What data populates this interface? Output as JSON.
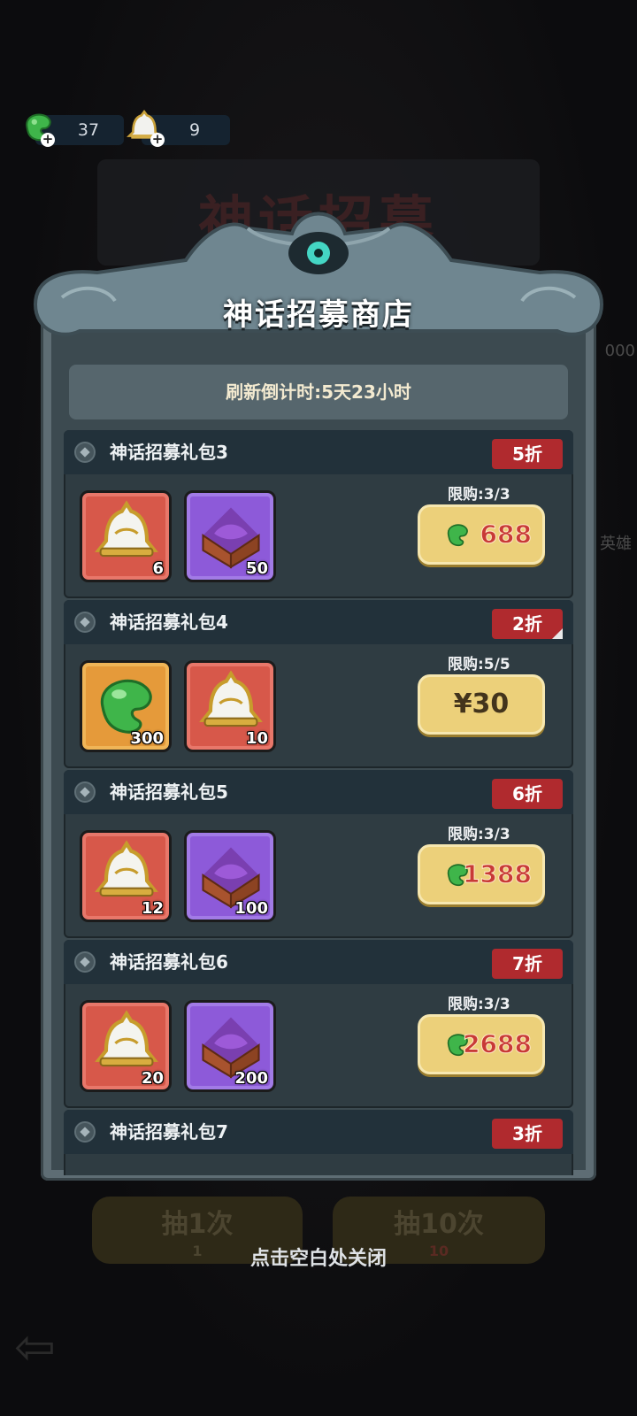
{
  "background": {
    "title": "神话招募",
    "side_number": "000",
    "side_label": "英雄",
    "draw_once": {
      "label": "抽1次",
      "cost": "1"
    },
    "draw_ten": {
      "label": "抽10次",
      "cost": "10"
    }
  },
  "currency": [
    {
      "icon": "jade-gem-icon",
      "value": "37"
    },
    {
      "icon": "bell-icon",
      "value": "9"
    }
  ],
  "shop": {
    "title": "神话招募商店",
    "refresh": "刷新倒计时:5天23小时",
    "close_hint": "点击空白处关闭",
    "packs": [
      {
        "name": "神话招募礼包3",
        "discount": "5折",
        "limit": "限购:3/3",
        "price": "688",
        "price_type": "gem",
        "items": [
          {
            "kind": "bell",
            "bg": "red",
            "qty": "6"
          },
          {
            "kind": "chest",
            "bg": "purple",
            "qty": "50"
          }
        ]
      },
      {
        "name": "神话招募礼包4",
        "discount": "2折",
        "limit": "限购:5/5",
        "price": "¥30",
        "price_type": "cash",
        "items": [
          {
            "kind": "gem",
            "bg": "orange",
            "qty": "300"
          },
          {
            "kind": "bell",
            "bg": "red",
            "qty": "10"
          }
        ]
      },
      {
        "name": "神话招募礼包5",
        "discount": "6折",
        "limit": "限购:3/3",
        "price": "1388",
        "price_type": "gem",
        "items": [
          {
            "kind": "bell",
            "bg": "red",
            "qty": "12"
          },
          {
            "kind": "chest",
            "bg": "purple",
            "qty": "100"
          }
        ]
      },
      {
        "name": "神话招募礼包6",
        "discount": "7折",
        "limit": "限购:3/3",
        "price": "2688",
        "price_type": "gem",
        "items": [
          {
            "kind": "bell",
            "bg": "red",
            "qty": "20"
          },
          {
            "kind": "chest",
            "bg": "purple",
            "qty": "200"
          }
        ]
      },
      {
        "name": "神话招募礼包7",
        "discount": "3折"
      }
    ]
  },
  "colors": {
    "discount_badge": "#b02a2e",
    "price_button": "#ecd07a",
    "price_text": "#c83a36",
    "panel": "#3c4a50"
  }
}
